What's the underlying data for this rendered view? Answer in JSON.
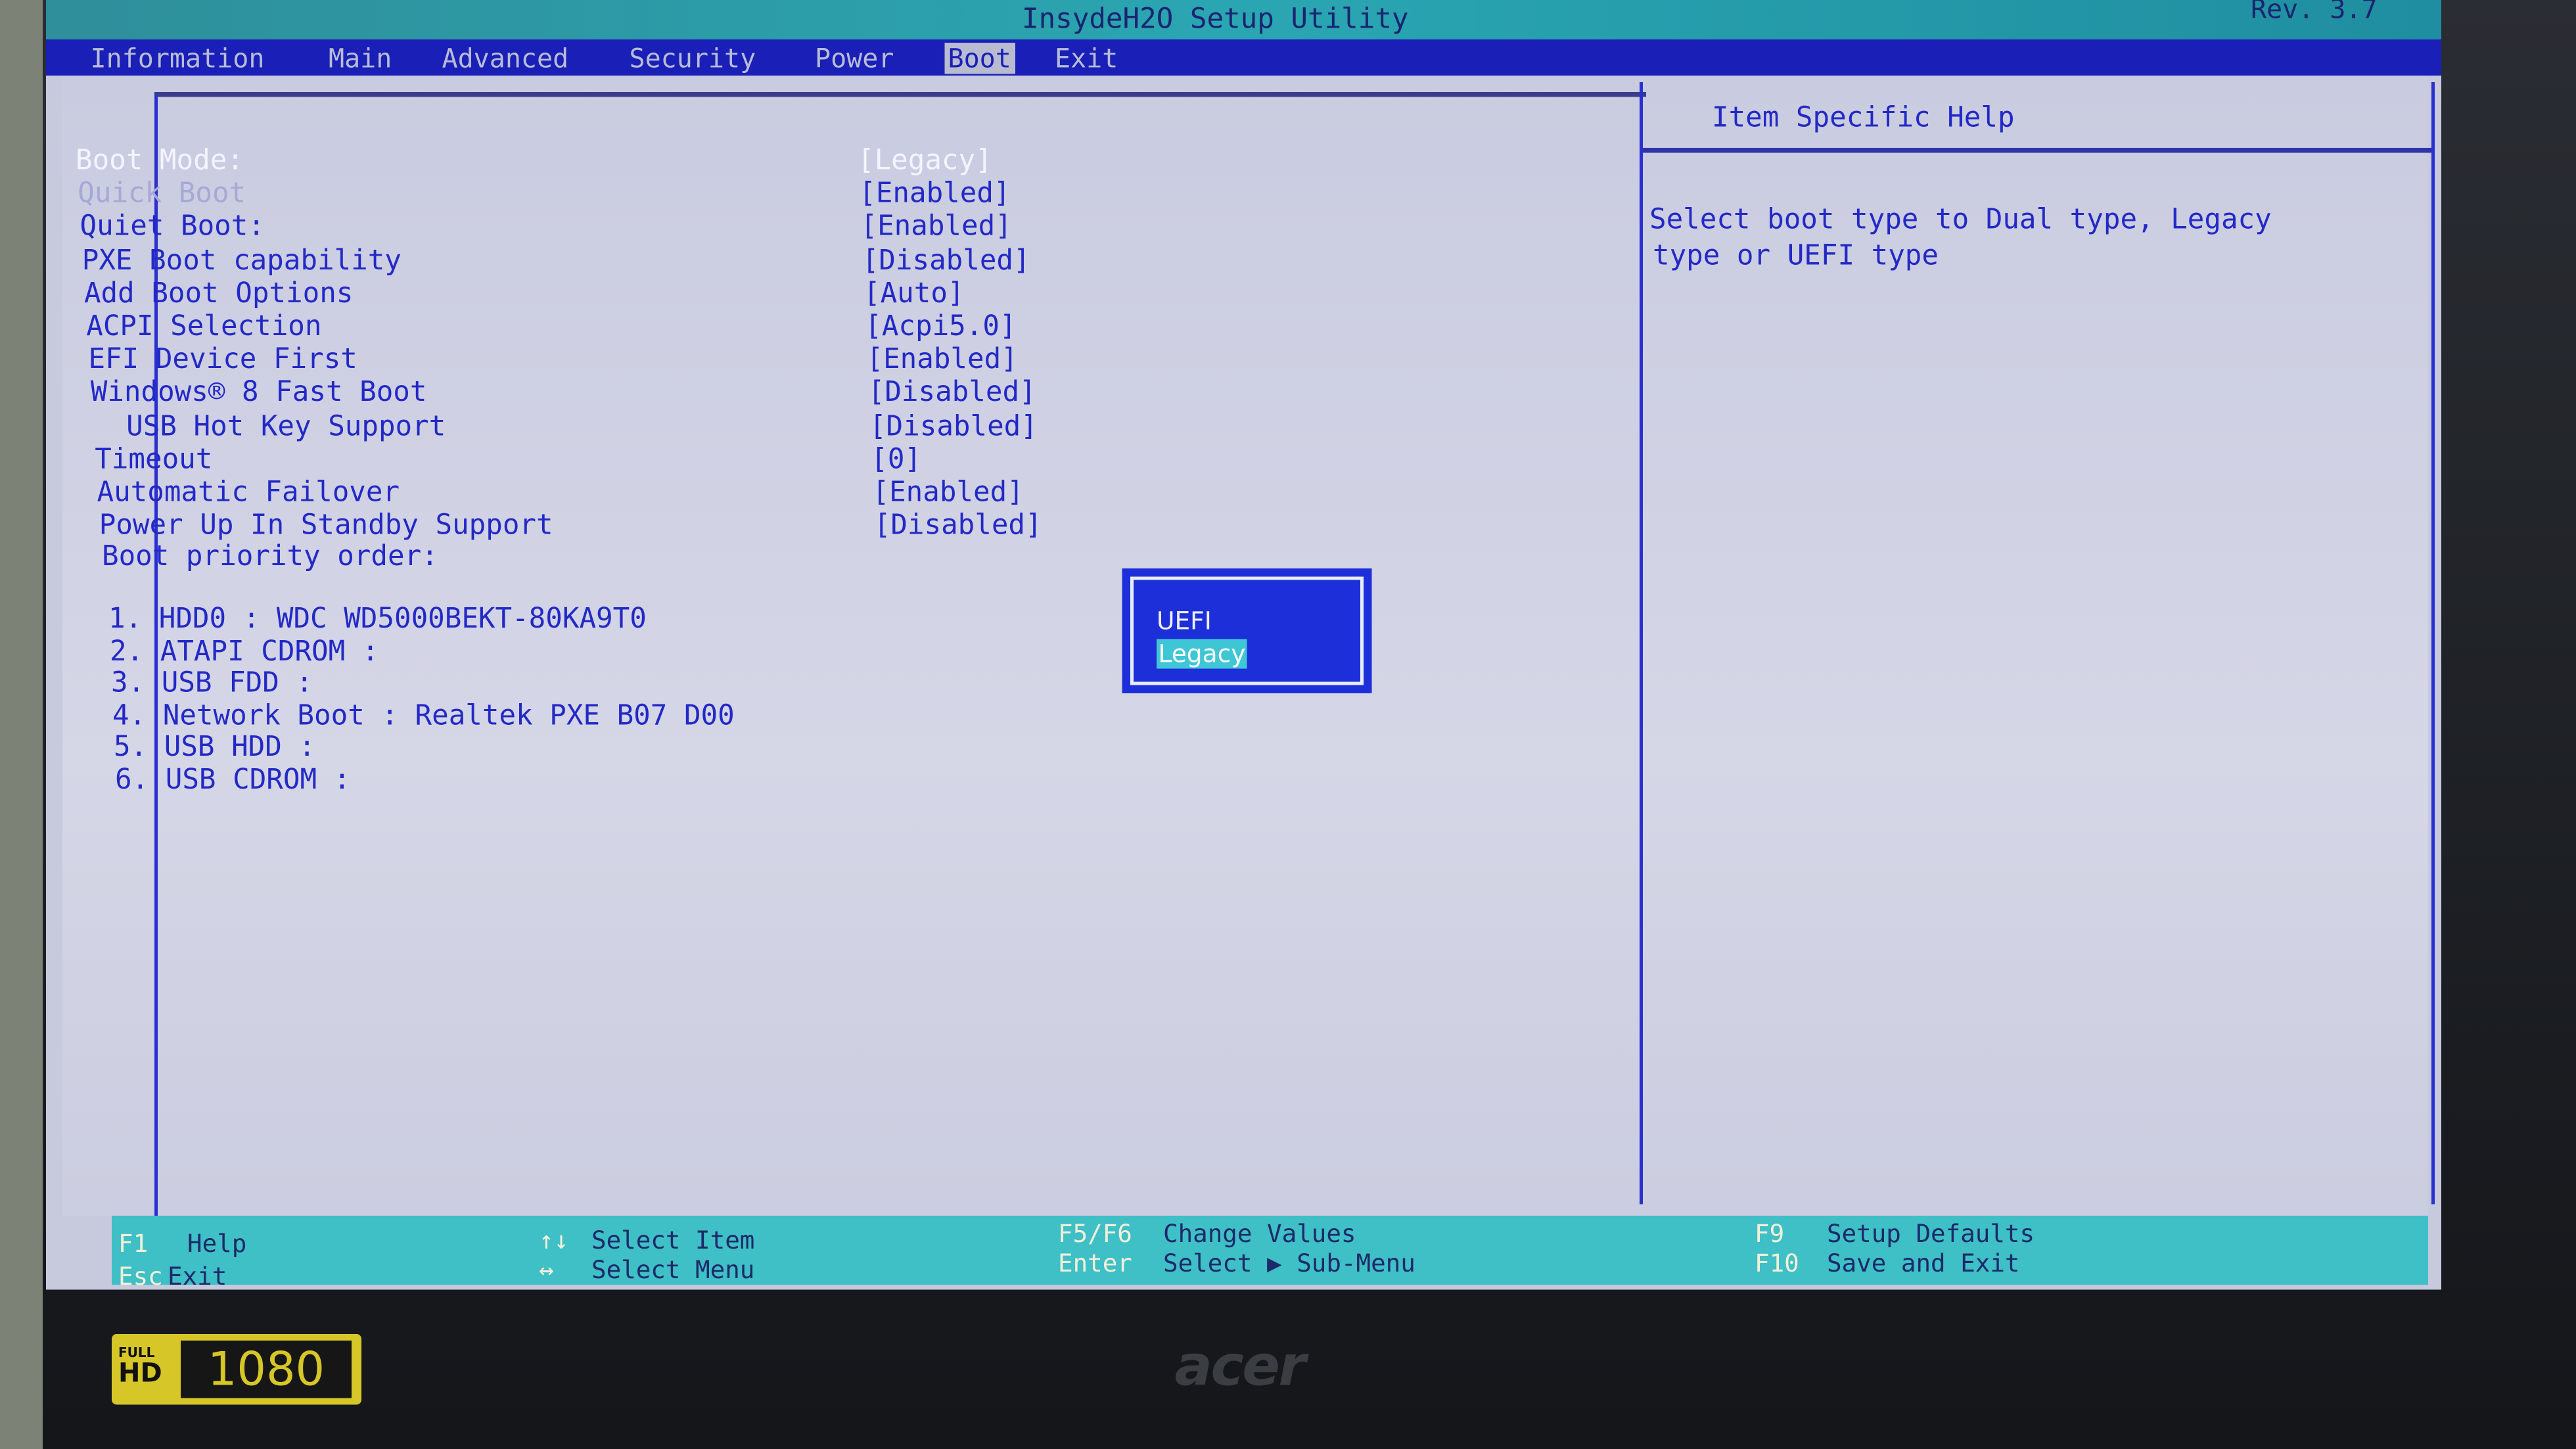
{
  "title": "InsydeH2O Setup Utility",
  "revision": "Rev. 3.7",
  "menu": [
    {
      "label": "Information",
      "selected": false
    },
    {
      "label": "Main",
      "selected": false
    },
    {
      "label": "Advanced",
      "selected": false
    },
    {
      "label": "Security",
      "selected": false
    },
    {
      "label": "Power",
      "selected": false
    },
    {
      "label": "Boot",
      "selected": true
    },
    {
      "label": "Exit",
      "selected": false
    }
  ],
  "settings": [
    {
      "label": "Boot Mode:",
      "value": "[Legacy]",
      "state": "highlighted"
    },
    {
      "label": "Quick Boot",
      "value": "[Enabled]",
      "state": "dimmed"
    },
    {
      "label": "Quiet Boot:",
      "value": "[Enabled]",
      "state": "normal"
    },
    {
      "label": "PXE Boot capability",
      "value": "[Disabled]",
      "state": "normal"
    },
    {
      "label": "Add Boot Options",
      "value": "[Auto]",
      "state": "normal"
    },
    {
      "label": "ACPI Selection",
      "value": "[Acpi5.0]",
      "state": "normal"
    },
    {
      "label": "EFI Device First",
      "value": "[Enabled]",
      "state": "normal"
    },
    {
      "label": "Windows® 8 Fast Boot",
      "value": "[Disabled]",
      "state": "normal"
    },
    {
      "label": "  USB Hot Key Support",
      "value": "[Disabled]",
      "state": "normal"
    },
    {
      "label": "Timeout",
      "value": "[0]",
      "state": "normal"
    },
    {
      "label": "Automatic Failover",
      "value": "[Enabled]",
      "state": "normal"
    },
    {
      "label": "Power Up In Standby Support",
      "value": "[Disabled]",
      "state": "normal"
    }
  ],
  "boot_priority_label": "Boot priority order:",
  "boot_priority": [
    "1. HDD0 : WDC WD5000BEKT-80KA9T0",
    "2. ATAPI CDROM :",
    "3. USB FDD :",
    "4. Network Boot : Realtek PXE B07 D00",
    "5. USB HDD :",
    "6. USB CDROM :"
  ],
  "help": {
    "title": "Item Specific Help",
    "lines": [
      "Select boot type to Dual type, Legacy",
      "type or UEFI type"
    ]
  },
  "popup": {
    "options": [
      {
        "label": "UEFI",
        "selected": false
      },
      {
        "label": "Legacy",
        "selected": true
      }
    ]
  },
  "footer": [
    {
      "key": "F1",
      "desc": "Help"
    },
    {
      "key": "Esc",
      "desc": "Exit"
    },
    {
      "key": "↑↓",
      "desc": "Select Item"
    },
    {
      "key": "↔",
      "desc": "Select Menu"
    },
    {
      "key": "F5/F6",
      "desc": "Change Values"
    },
    {
      "key": "Enter",
      "desc": "Select ▶ Sub-Menu"
    },
    {
      "key": "F9",
      "desc": "Setup Defaults"
    },
    {
      "key": "F10",
      "desc": "Save and Exit"
    }
  ],
  "bezel": {
    "brand_logo": "acer",
    "badge_left": "FULL HD",
    "badge_right": "1080"
  },
  "colors": {
    "menu_bar": "#1a1fb8",
    "text": "#2329c6",
    "footer": "#3fbfc6",
    "popup": "#1d2fd8",
    "background": "#c7c9dd"
  }
}
